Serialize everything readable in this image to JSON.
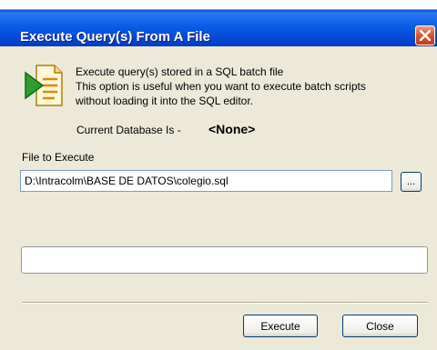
{
  "dialog": {
    "title": "Execute Query(s) From A File",
    "close_icon": "close-x-icon",
    "doc_icon": "sql-batch-document-icon"
  },
  "info": {
    "line1": "Execute query(s) stored in a SQL batch file",
    "line2": "This option is useful when you want to execute batch scripts",
    "line3": "without loading it into the SQL editor."
  },
  "database": {
    "label": "Current Database Is -",
    "value": "<None>"
  },
  "file": {
    "label": "File to Execute",
    "value": "D:\\Intracolm\\BASE DE DATOS\\colegio.sql",
    "browse_label": "..."
  },
  "progress": {
    "value": 0
  },
  "buttons": {
    "execute": "Execute",
    "close": "Close"
  },
  "colors": {
    "titlebar": "#0b5ee8",
    "client_bg": "#ece9d8",
    "close_button": "#d8532f"
  }
}
